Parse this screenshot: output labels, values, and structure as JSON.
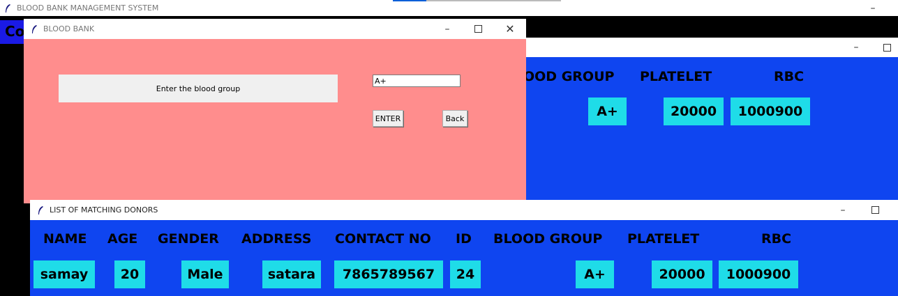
{
  "main_window": {
    "title": "BLOOD BANK MANAGEMENT SYSTEM",
    "partial_label": "Co"
  },
  "back_window": {
    "headers": {
      "blood_group": "OOD GROUP",
      "platelet": "PLATELET",
      "rbc": "RBC"
    },
    "row": {
      "blood_group": "A+",
      "platelet": "20000",
      "rbc": "1000900"
    }
  },
  "dialog": {
    "title": "BLOOD BANK",
    "prompt": "Enter the blood group",
    "input_value": "A+",
    "enter_label": "ENTER",
    "back_label": "Back"
  },
  "donors_window": {
    "title": "LIST OF MATCHING DONORS",
    "headers": {
      "name": "NAME",
      "age": "AGE",
      "gender": "GENDER",
      "address": "ADDRESS",
      "contact": "CONTACT NO",
      "id": "ID",
      "blood_group": "BLOOD GROUP",
      "platelet": "PLATELET",
      "rbc": "RBC"
    },
    "row": {
      "name": "samay",
      "age": "20",
      "gender": "Male",
      "address": "satara",
      "contact": "7865789567",
      "id": "24",
      "blood_group": "A+",
      "platelet": "20000",
      "rbc": "1000900"
    }
  },
  "colors": {
    "blue": "#0f45f0",
    "cyan": "#1fdce8",
    "pink": "#ff8d8d"
  }
}
